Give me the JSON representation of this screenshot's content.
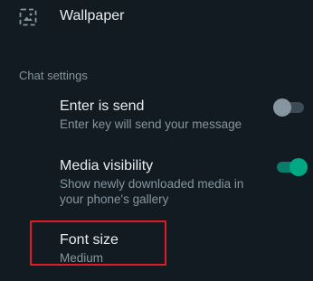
{
  "wallpaper": {
    "icon": "wallpaper-icon",
    "label": "Wallpaper"
  },
  "chat_settings": {
    "section_title": "Chat settings",
    "enter_is_send": {
      "title": "Enter is send",
      "subtitle": "Enter key will send your message",
      "enabled": false
    },
    "media_visibility": {
      "title": "Media visibility",
      "subtitle": "Show newly downloaded media in your phone's gallery",
      "enabled": true
    },
    "font_size": {
      "title": "Font size",
      "value": "Medium"
    }
  },
  "colors": {
    "background": "#111b21",
    "primary_text": "#e9edef",
    "secondary_text": "#8696a0",
    "accent": "#00a884",
    "highlight": "#e01b24"
  }
}
